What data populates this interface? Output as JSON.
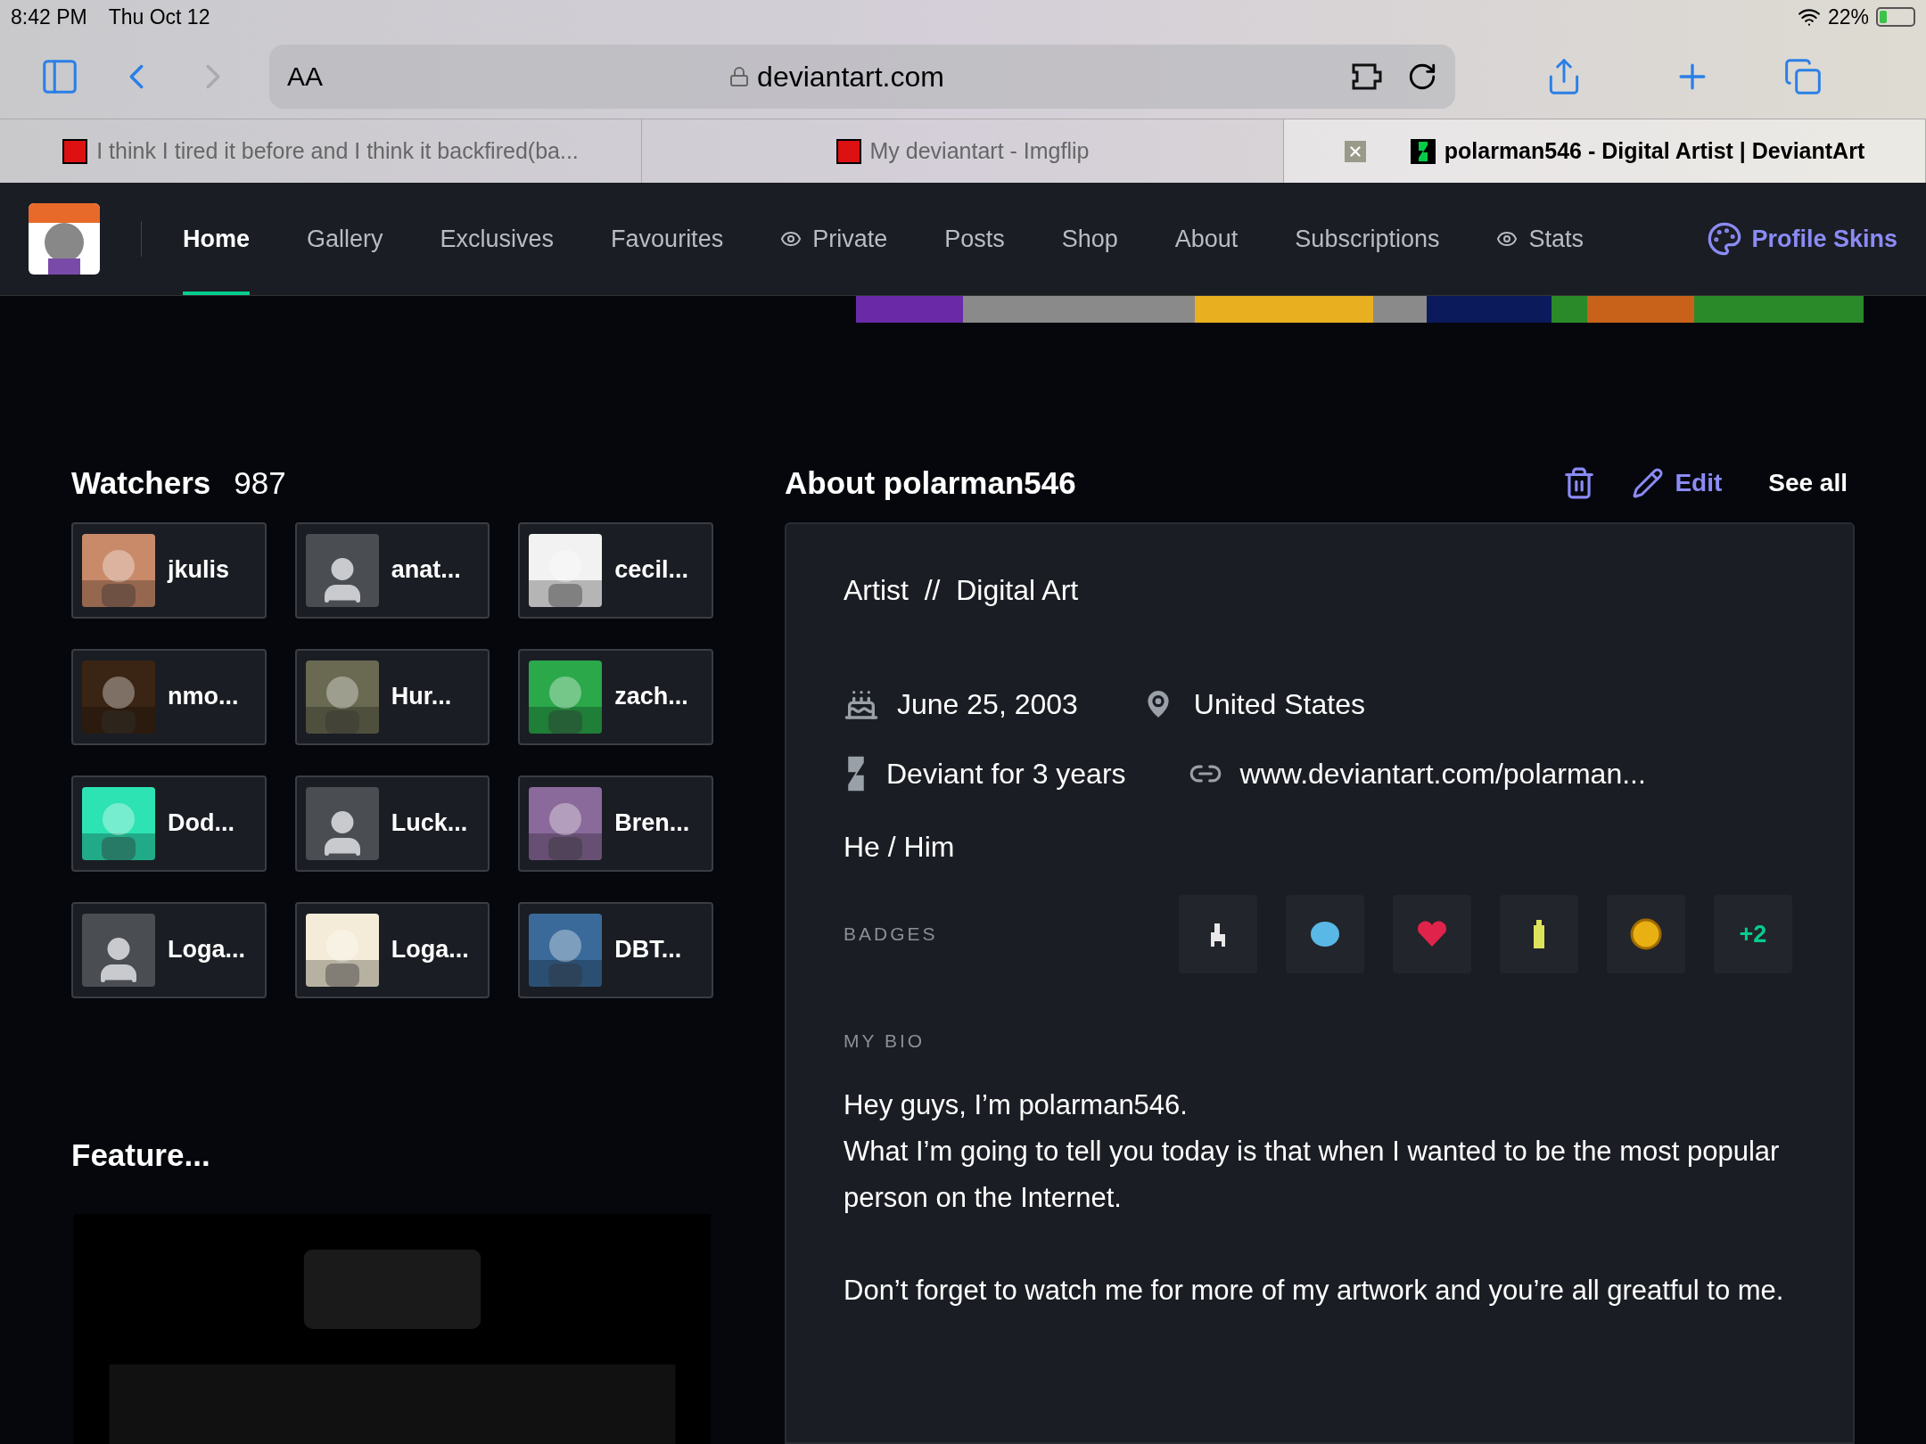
{
  "status_bar": {
    "time": "8:42 PM",
    "date": "Thu Oct 12",
    "battery": "22%"
  },
  "browser": {
    "text_size": "AA",
    "url": "deviantart.com",
    "tabs": [
      {
        "title": "I think I tired it before and I think it backfired(ba...",
        "kind": "imgflip",
        "selected": false
      },
      {
        "title": "My deviantart - Imgflip",
        "kind": "imgflip",
        "selected": false
      },
      {
        "title": "polarman546 - Digital Artist | DeviantArt",
        "kind": "deviantart",
        "selected": true
      }
    ]
  },
  "nav": {
    "items": [
      {
        "label": "Home",
        "selected": true,
        "kind": "plain"
      },
      {
        "label": "Gallery",
        "selected": false,
        "kind": "plain"
      },
      {
        "label": "Exclusives",
        "selected": false,
        "kind": "plain"
      },
      {
        "label": "Favourites",
        "selected": false,
        "kind": "plain"
      },
      {
        "label": "Private",
        "selected": false,
        "kind": "hidden"
      },
      {
        "label": "Posts",
        "selected": false,
        "kind": "plain"
      },
      {
        "label": "Shop",
        "selected": false,
        "kind": "plain"
      },
      {
        "label": "About",
        "selected": false,
        "kind": "plain"
      },
      {
        "label": "Subscriptions",
        "selected": false,
        "kind": "plain"
      },
      {
        "label": "Stats",
        "selected": false,
        "kind": "hidden"
      }
    ],
    "profile_skins": "Profile Skins"
  },
  "watchers": {
    "title": "Watchers",
    "count": "987",
    "items": [
      {
        "name": "jkulis",
        "kind": "picture"
      },
      {
        "name": "anat...",
        "kind": "default"
      },
      {
        "name": "cecil...",
        "kind": "picture"
      },
      {
        "name": "nmo...",
        "kind": "picture"
      },
      {
        "name": "Hur...",
        "kind": "picture"
      },
      {
        "name": "zach...",
        "kind": "picture"
      },
      {
        "name": "Dod...",
        "kind": "picture"
      },
      {
        "name": "Luck...",
        "kind": "default"
      },
      {
        "name": "Bren...",
        "kind": "picture"
      },
      {
        "name": "Loga...",
        "kind": "default"
      },
      {
        "name": "Loga...",
        "kind": "picture"
      },
      {
        "name": "DBT...",
        "kind": "picture"
      }
    ]
  },
  "featured": {
    "title": "Feature..."
  },
  "about": {
    "title": "About polarman546",
    "edit": "Edit",
    "see_all": "See all",
    "headline": "Artist  //  Digital Art",
    "birthday": "June 25, 2003",
    "location": "United States",
    "member_for": "Deviant for 3 years",
    "website": "www.deviantart.com/polarman...",
    "pronouns": "He / Him",
    "badges_label": "BADGES",
    "badges_more": "+2",
    "bio_label": "MY BIO",
    "bio": [
      [
        "Hey guys, I’m polarman546.",
        "What I’m going to tell you today is that when I wanted to be the most popular person on the Internet."
      ],
      [
        "Don’t forget to watch me for more of my artwork and you’re all greatful to me."
      ]
    ]
  }
}
